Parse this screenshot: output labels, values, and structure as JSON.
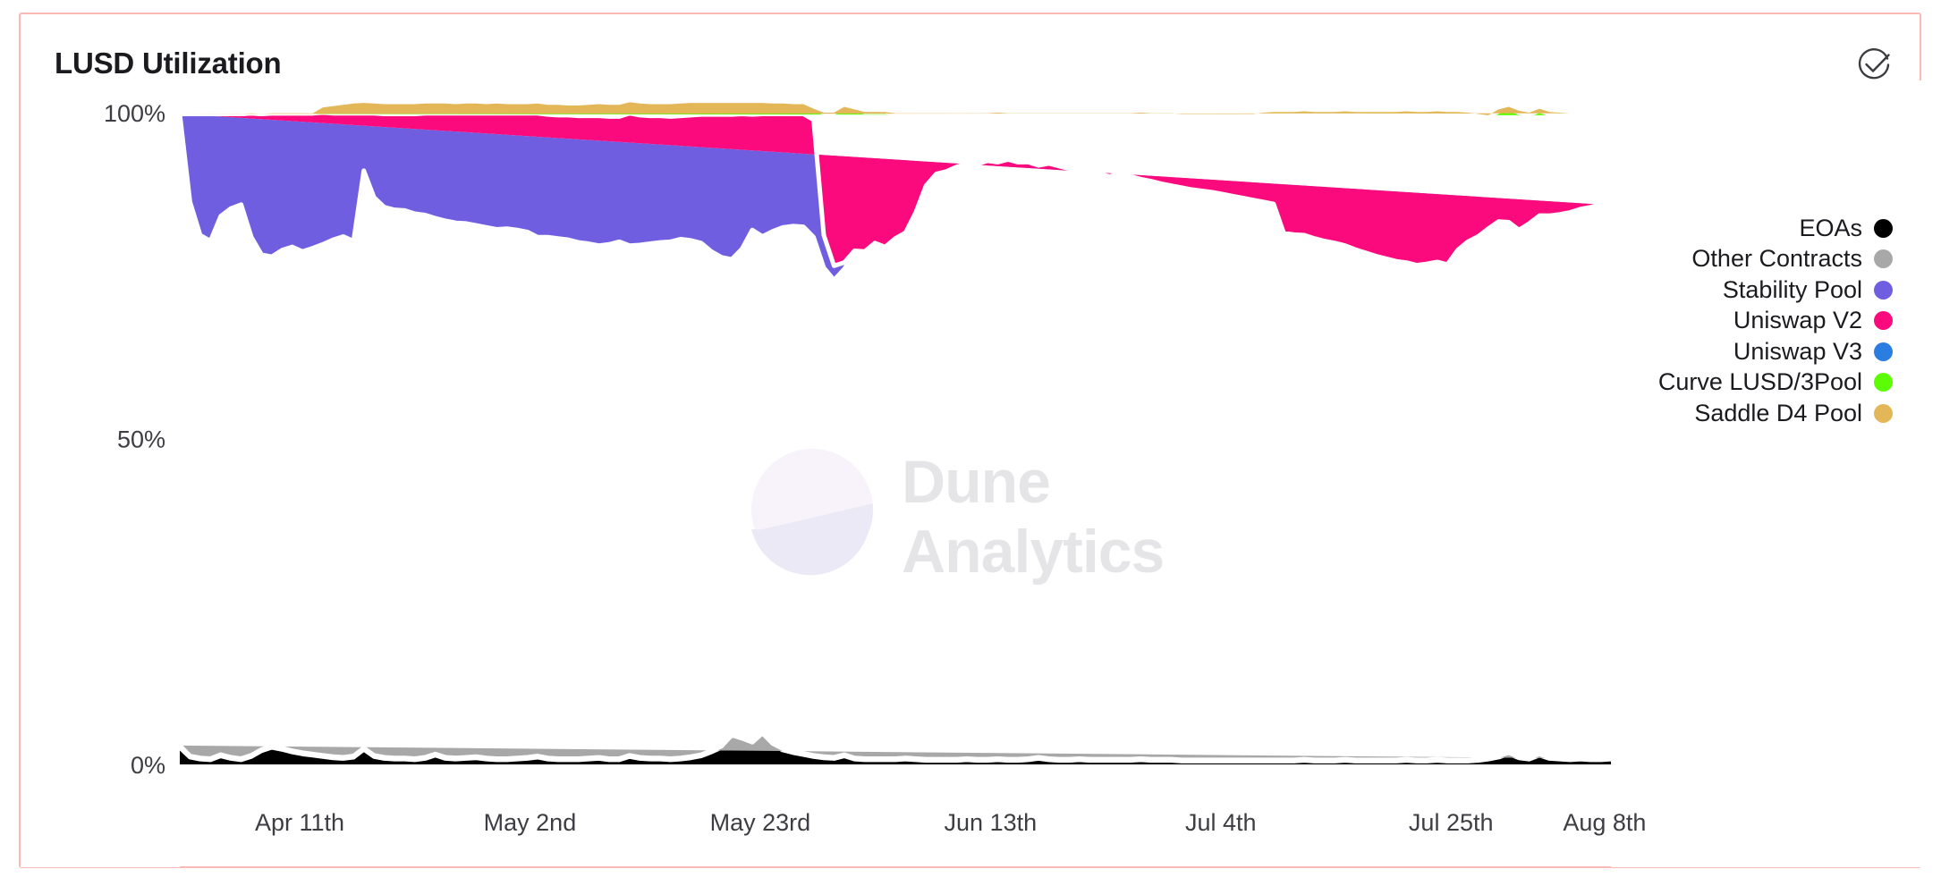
{
  "card": {
    "title": "LUSD Utilization",
    "header_icon": "circle-check-icon",
    "border_color": "#fab9b4",
    "background": "#ffffff"
  },
  "watermark": {
    "line1": "Dune",
    "line2": "Analytics"
  },
  "legend": {
    "position": "right",
    "items": [
      {
        "label": "EOAs",
        "color": "#000000"
      },
      {
        "label": "Other Contracts",
        "color": "#a8a8a8"
      },
      {
        "label": "Stability Pool",
        "color": "#6f5fe0"
      },
      {
        "label": "Uniswap V2",
        "color": "#fb0a7d"
      },
      {
        "label": "Uniswap V3",
        "color": "#2a7de1"
      },
      {
        "label": "Curve LUSD/3Pool",
        "color": "#5bfc04"
      },
      {
        "label": "Saddle D4 Pool",
        "color": "#e3b757"
      }
    ]
  },
  "chart_data": {
    "type": "area",
    "stacked": true,
    "stack_mode": "percent",
    "title": "LUSD Utilization",
    "xlabel": "",
    "ylabel": "",
    "ylim": [
      0,
      100
    ],
    "ytick_labels": [
      "100%",
      "50%",
      "0%"
    ],
    "ytick_values": [
      100,
      50,
      0
    ],
    "grid": false,
    "separator_color": "#ffffff",
    "x_tick_labels": [
      "Apr 11th",
      "May 2nd",
      "May 23rd",
      "Jun 13th",
      "Jul 4th",
      "Jul 25th",
      "Aug 8th"
    ],
    "x_tick_positions": [
      0.043,
      0.178,
      0.313,
      0.448,
      0.583,
      0.718,
      0.808
    ],
    "x_range_start": "Apr 5th",
    "x_range_end": "Aug 21st",
    "n_points": 139,
    "series": [
      {
        "name": "EOAs",
        "color": "#000000",
        "values": [
          2.6,
          1.1,
          0.8,
          0.7,
          1.3,
          0.9,
          0.7,
          1.2,
          2.1,
          2.6,
          2.3,
          1.9,
          1.6,
          1.4,
          1.2,
          1.0,
          0.9,
          1.1,
          2.3,
          1.2,
          0.9,
          0.8,
          0.8,
          0.7,
          0.9,
          1.4,
          0.9,
          0.8,
          0.9,
          1.0,
          0.8,
          0.7,
          0.7,
          0.8,
          0.9,
          1.1,
          0.8,
          0.7,
          0.7,
          0.7,
          0.8,
          0.9,
          0.7,
          0.7,
          1.2,
          0.9,
          0.8,
          0.8,
          0.7,
          0.8,
          1.0,
          1.3,
          1.9,
          2.6,
          4.3,
          3.8,
          3.2,
          4.6,
          3.0,
          2.2,
          1.8,
          1.5,
          1.2,
          1.0,
          0.9,
          1.3,
          0.8,
          0.7,
          0.7,
          0.7,
          0.7,
          0.8,
          0.7,
          0.6,
          0.6,
          0.6,
          0.6,
          0.7,
          0.6,
          0.6,
          0.7,
          0.6,
          0.6,
          0.7,
          0.9,
          0.7,
          0.6,
          0.6,
          0.7,
          0.6,
          0.6,
          0.6,
          0.6,
          0.6,
          0.7,
          0.6,
          0.6,
          0.6,
          0.5,
          0.5,
          0.5,
          0.5,
          0.5,
          0.5,
          0.5,
          0.5,
          0.5,
          0.5,
          0.5,
          0.5,
          0.6,
          0.5,
          0.5,
          0.5,
          0.6,
          0.5,
          0.5,
          0.5,
          0.5,
          0.5,
          0.6,
          0.5,
          0.5,
          0.6,
          0.5,
          0.5,
          0.5,
          0.6,
          0.8,
          1.1,
          1.6,
          1.0,
          0.8,
          1.4,
          0.9,
          0.8,
          0.7,
          0.8,
          0.7,
          0.7,
          0.8
        ]
      },
      {
        "name": "Other Contracts",
        "color": "#a8a8a8",
        "values": [
          0.3,
          0.2,
          0.2,
          0.2,
          0.2,
          0.2,
          0.2,
          0.2,
          0.2,
          0.2,
          0.2,
          0.2,
          0.2,
          0.2,
          0.2,
          0.2,
          0.2,
          0.2,
          0.2,
          0.2,
          0.2,
          0.2,
          0.2,
          0.2,
          0.2,
          0.2,
          0.2,
          0.2,
          0.2,
          0.2,
          0.2,
          0.2,
          0.2,
          0.2,
          0.2,
          0.2,
          0.2,
          0.2,
          0.2,
          0.2,
          0.2,
          0.2,
          0.2,
          0.2,
          0.2,
          0.2,
          0.2,
          0.2,
          0.2,
          0.2,
          0.2,
          0.2,
          0.2,
          0.2,
          0.2,
          0.2,
          0.2,
          0.2,
          0.2,
          0.2,
          0.2,
          0.2,
          0.2,
          0.2,
          0.2,
          0.2,
          0.2,
          0.2,
          0.2,
          0.2,
          0.2,
          0.2,
          0.2,
          0.2,
          0.2,
          0.2,
          0.2,
          0.2,
          0.2,
          0.2,
          0.2,
          0.2,
          0.2,
          0.2,
          0.2,
          0.2,
          0.2,
          0.2,
          0.2,
          0.2,
          0.2,
          0.2,
          0.2,
          0.2,
          0.2,
          0.2,
          0.2,
          0.2,
          0.2,
          0.2,
          0.2,
          0.2,
          0.2,
          0.2,
          0.2,
          0.2,
          0.2,
          0.2,
          0.2,
          0.2,
          0.2,
          0.2,
          0.2,
          0.2,
          0.2,
          0.2,
          0.2,
          0.2,
          0.2,
          0.2,
          0.2,
          0.2,
          0.2,
          0.2,
          0.2,
          0.2,
          0.2,
          0.2,
          0.2,
          0.2,
          0.2,
          0.2,
          0.2,
          0.2,
          0.2,
          0.2,
          0.2,
          0.2,
          0.2,
          0.2
        ]
      },
      {
        "name": "Stability Pool",
        "color": "#6f5fe0",
        "values": [
          96.9,
          85.0,
          80.2,
          79.4,
          82.6,
          84.2,
          85.0,
          79.5,
          75.9,
          75.1,
          76.4,
          77.3,
          76.9,
          77.6,
          78.4,
          79.3,
          79.9,
          79.0,
          88.6,
          85.6,
          84.4,
          84.1,
          84.0,
          83.6,
          83.2,
          82.2,
          82.3,
          82.1,
          81.9,
          81.5,
          81.4,
          81.2,
          81.3,
          81.0,
          80.6,
          79.6,
          79.9,
          79.8,
          79.6,
          79.2,
          78.9,
          78.5,
          78.9,
          79.3,
          78.2,
          78.6,
          78.9,
          79.1,
          79.3,
          79.6,
          79.2,
          78.5,
          76.6,
          75.0,
          73.0,
          75.1,
          78.6,
          76.2,
          78.6,
          80.0,
          80.6,
          80.8,
          79.5,
          75.0,
          73.2,
          74.5,
          77.4,
          77.6,
          79.0,
          78.4,
          79.8,
          80.6,
          83.8,
          88.0,
          89.8,
          90.2,
          90.9,
          91.2,
          91.3,
          91.8,
          91.5,
          92.0,
          91.6,
          91.5,
          90.8,
          91.3,
          91.0,
          90.6,
          90.3,
          90.1,
          89.8,
          89.4,
          89.9,
          89.4,
          88.9,
          88.7,
          88.3,
          88.0,
          87.8,
          87.5,
          87.3,
          87.1,
          86.8,
          86.5,
          86.2,
          85.9,
          85.6,
          85.3,
          80.8,
          80.6,
          80.4,
          80.0,
          79.6,
          79.3,
          78.8,
          78.3,
          77.8,
          77.3,
          76.9,
          76.5,
          76.2,
          75.9,
          76.1,
          76.3,
          76.0,
          78.2,
          79.5,
          80.2,
          81.2,
          82.0,
          81.4,
          80.8,
          82.0,
          82.6,
          83.1,
          83.4,
          83.8,
          84.2,
          84.6,
          85.0
        ]
      },
      {
        "name": "Uniswap V2",
        "color": "#fb0a7d",
        "values": [
          0.0,
          13.5,
          18.6,
          19.5,
          15.7,
          14.5,
          13.9,
          19.0,
          21.6,
          22.0,
          21.0,
          20.5,
          21.2,
          20.7,
          20.2,
          19.4,
          18.9,
          19.6,
          8.8,
          12.9,
          14.3,
          14.7,
          14.8,
          15.3,
          15.6,
          16.1,
          16.5,
          16.8,
          16.9,
          17.2,
          17.5,
          17.8,
          17.7,
          17.9,
          18.2,
          19.0,
          18.8,
          18.9,
          19.1,
          19.4,
          19.6,
          19.9,
          19.6,
          19.2,
          20.3,
          19.9,
          19.6,
          19.4,
          19.2,
          18.9,
          19.2,
          19.7,
          21.0,
          21.9,
          22.2,
          20.7,
          17.7,
          18.8,
          18.0,
          17.4,
          17.2,
          17.3,
          18.0,
          5.0,
          2.2,
          1.0,
          0.4,
          0.2,
          0.1,
          0.1,
          0.0,
          0.0,
          0.0,
          0.0,
          0.0,
          0.0,
          0.0,
          0.0,
          0.0,
          0.0,
          0.0,
          0.0,
          0.0,
          0.0,
          0.0,
          0.0,
          0.0,
          0.0,
          0.0,
          0.0,
          0.0,
          0.0,
          0.0,
          0.0,
          0.0,
          0.0,
          0.0,
          0.0,
          0.0,
          0.0,
          0.0,
          0.0,
          0.0,
          0.0,
          0.0,
          0.0,
          0.0,
          0.0,
          0.0,
          0.0,
          0.0,
          0.0,
          0.0,
          0.0,
          0.0,
          0.0,
          0.0,
          0.0,
          0.0,
          0.0,
          0.0,
          0.0,
          0.0,
          0.0,
          0.0,
          0.0,
          0.0,
          0.0,
          0.0,
          0.0,
          0.0,
          0.0,
          0.0,
          0.0,
          0.0,
          0.0,
          0.0,
          0.0,
          0.0,
          0.0
        ]
      },
      {
        "name": "Uniswap V3",
        "color": "#2a7de1",
        "values": [
          0.0,
          0.0,
          0.0,
          0.0,
          0.0,
          0.0,
          0.0,
          0.0,
          0.0,
          0.0,
          0.0,
          0.0,
          0.0,
          0.0,
          0.0,
          0.0,
          0.0,
          0.0,
          0.0,
          0.0,
          0.0,
          0.0,
          0.0,
          0.0,
          0.0,
          0.0,
          0.0,
          0.0,
          0.0,
          0.0,
          0.0,
          0.0,
          0.0,
          0.0,
          0.0,
          0.0,
          0.0,
          0.0,
          0.0,
          0.0,
          0.0,
          0.0,
          0.0,
          0.0,
          0.0,
          0.0,
          0.0,
          0.0,
          0.0,
          0.0,
          0.0,
          0.0,
          0.0,
          0.0,
          0.0,
          0.0,
          0.0,
          0.0,
          0.0,
          0.0,
          0.0,
          0.0,
          0.0,
          0.0,
          0.0,
          0.0,
          0.0,
          0.0,
          0.0,
          0.0,
          0.0,
          0.0,
          0.0,
          0.0,
          0.0,
          0.0,
          0.0,
          0.0,
          0.0,
          0.0,
          0.0,
          0.0,
          0.0,
          0.0,
          0.0,
          0.0,
          0.0,
          0.0,
          0.0,
          0.0,
          0.0,
          0.0,
          0.0,
          0.0,
          0.0,
          0.0,
          0.0,
          0.0,
          0.0,
          0.0,
          0.0,
          0.0,
          0.0,
          0.0,
          0.0,
          0.0,
          0.0,
          0.0,
          0.0,
          0.0,
          0.0,
          0.0,
          0.0,
          0.0,
          0.0,
          0.0,
          0.0,
          0.0,
          0.0,
          0.0,
          0.0,
          0.0,
          0.0,
          0.0,
          0.0,
          0.0,
          0.0,
          0.0,
          0.0,
          0.0,
          0.0,
          0.0,
          0.0,
          0.0,
          0.0,
          0.0,
          0.0
        ]
      },
      {
        "name": "Curve LUSD/3Pool",
        "color": "#5bfc04",
        "values": [
          0.0,
          0.0,
          0.0,
          0.0,
          0.0,
          0.0,
          0.0,
          0.0,
          0.0,
          0.0,
          0.0,
          0.0,
          0.0,
          0.0,
          0.8,
          1.1,
          1.3,
          1.5,
          1.6,
          1.5,
          1.5,
          1.5,
          1.5,
          1.5,
          1.5,
          1.5,
          1.5,
          1.4,
          1.5,
          1.5,
          1.4,
          1.5,
          1.4,
          1.4,
          1.4,
          1.5,
          1.5,
          1.6,
          1.5,
          1.6,
          1.7,
          1.8,
          1.8,
          1.8,
          1.7,
          1.8,
          1.8,
          1.8,
          1.9,
          1.9,
          1.9,
          1.8,
          1.8,
          1.8,
          1.8,
          1.7,
          1.8,
          1.7,
          1.6,
          1.6,
          1.5,
          1.5,
          1.7,
          18.8,
          23.5,
          23.9,
          21.7,
          21.4,
          20.1,
          20.7,
          19.2,
          18.3,
          15.2,
          11.1,
          9.3,
          8.9,
          8.2,
          7.8,
          7.8,
          7.3,
          7.6,
          7.1,
          7.5,
          7.5,
          8.0,
          7.7,
          8.1,
          8.5,
          8.7,
          9.0,
          9.3,
          9.7,
          9.2,
          9.7,
          10.2,
          10.4,
          10.8,
          11.1,
          11.3,
          11.6,
          11.8,
          12.0,
          12.3,
          12.6,
          12.9,
          13.2,
          13.5,
          13.8,
          18.3,
          18.5,
          18.7,
          19.1,
          19.5,
          19.8,
          20.3,
          20.8,
          21.3,
          21.8,
          22.2,
          22.6,
          22.9,
          23.2,
          23.0,
          22.8,
          23.1,
          20.9,
          19.5,
          18.5,
          17.1,
          16.9,
          17.4,
          18.0,
          16.7,
          16.1,
          15.6,
          15.3,
          14.9,
          14.5,
          14.1,
          13.7
        ]
      },
      {
        "name": "Saddle D4 Pool",
        "color": "#e3b757",
        "values": [
          0.0,
          0.0,
          0.0,
          0.0,
          0.0,
          0.0,
          0.0,
          0.0,
          0.0,
          0.0,
          0.0,
          0.0,
          0.0,
          0.0,
          0.0,
          0.0,
          0.0,
          0.0,
          0.0,
          0.0,
          0.0,
          0.0,
          0.0,
          0.0,
          0.0,
          0.0,
          0.0,
          0.0,
          0.0,
          0.0,
          0.0,
          0.0,
          0.0,
          0.0,
          0.0,
          0.0,
          0.0,
          0.0,
          0.0,
          0.0,
          0.0,
          0.0,
          0.0,
          0.0,
          0.0,
          0.0,
          0.0,
          0.0,
          0.0,
          0.0,
          0.0,
          0.0,
          0.0,
          0.0,
          0.0,
          0.0,
          0.0,
          0.0,
          0.0,
          0.0,
          0.0,
          0.0,
          0.0,
          0.0,
          0.0,
          0.0,
          0.0,
          0.0,
          0.0,
          0.0,
          0.0,
          0.0,
          0.0,
          0.0,
          0.0,
          0.0,
          0.0,
          0.0,
          0.0,
          0.0,
          0.0,
          0.0,
          0.0,
          0.0,
          0.0,
          0.0,
          0.0,
          0.0,
          0.0,
          0.0,
          0.0,
          0.0,
          0.0,
          0.0,
          0.0,
          0.0,
          0.0,
          0.0,
          0.0,
          0.0,
          0.0,
          0.0,
          0.0,
          0.0,
          0.0,
          0.0,
          0.2,
          0.3,
          0.3,
          0.3,
          0.3,
          0.3,
          0.3,
          0.3,
          0.3,
          0.3,
          0.3,
          0.3,
          0.3,
          0.3,
          0.3,
          0.3,
          0.3,
          0.3,
          0.3,
          0.3,
          0.3,
          0.3,
          0.3,
          0.3,
          0.3,
          0.3,
          0.3,
          0.3,
          0.3,
          0.3,
          0.3,
          0.3
        ]
      }
    ]
  }
}
